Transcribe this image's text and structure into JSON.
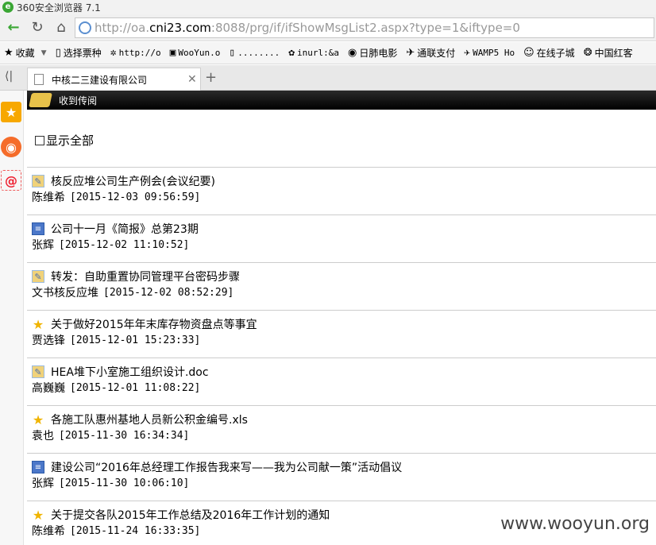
{
  "browser": {
    "title": "360安全浏览器 7.1",
    "url_prefix": "http://oa.",
    "url_host": "cni23.com",
    "url_rest": ":8088/prg/if/ifShowMsgList2.aspx?type=1&iftype=0",
    "bookmarks": [
      {
        "label": "收藏",
        "icon": "star-icon"
      },
      {
        "label": "选择票种",
        "icon": "page-icon"
      },
      {
        "label": "http://o",
        "icon": "gear-icon"
      },
      {
        "label": "WooYun.o",
        "icon": "wooyun-icon"
      },
      {
        "label": "........",
        "icon": "page-icon"
      },
      {
        "label": "inurl:&a",
        "icon": "paw-icon"
      },
      {
        "label": "日肺电影",
        "icon": "play-icon"
      },
      {
        "label": "通联支付",
        "icon": "pay-icon"
      },
      {
        "label": "WAMP5 Ho",
        "icon": "pay-icon"
      },
      {
        "label": "在线子城",
        "icon": "face-icon"
      },
      {
        "label": "中国红客",
        "icon": "badge-icon"
      }
    ],
    "tab_title": "中核二三建设有限公司"
  },
  "page": {
    "header_title": "收到传阅",
    "show_all_label": "显示全部",
    "items": [
      {
        "icon": "pen",
        "title": "核反应堆公司生产例会(会议纪要)",
        "sender": "陈维希",
        "time": "[2015-12-03 09:56:59]"
      },
      {
        "icon": "doc",
        "title": "公司十一月《简报》总第23期",
        "sender": "张辉",
        "time": "[2015-12-02 11:10:52]"
      },
      {
        "icon": "pen",
        "title": "转发：自助重置协同管理平台密码步骤",
        "sender": "文书核反应堆",
        "time": "[2015-12-02 08:52:29]"
      },
      {
        "icon": "star",
        "title": "关于做好2015年年末库存物资盘点等事宜",
        "sender": "贾选锋",
        "time": "[2015-12-01 15:23:33]"
      },
      {
        "icon": "pen",
        "title": "HEA堆下小室施工组织设计.doc",
        "sender": "高巍巍",
        "time": "[2015-12-01 11:08:22]"
      },
      {
        "icon": "star",
        "title": "各施工队惠州基地人员新公积金编号.xls",
        "sender": "袁也",
        "time": "[2015-11-30 16:34:34]"
      },
      {
        "icon": "doc",
        "title": "建设公司“2016年总经理工作报告我来写——我为公司献一策”活动倡议",
        "sender": "张辉",
        "time": "[2015-11-30 10:06:10]"
      },
      {
        "icon": "star",
        "title": "关于提交各队2015年工作总结及2016年工作计划的通知",
        "sender": "陈维希",
        "time": "[2015-11-24 16:33:35]"
      }
    ]
  },
  "watermark": "www.wooyun.org"
}
